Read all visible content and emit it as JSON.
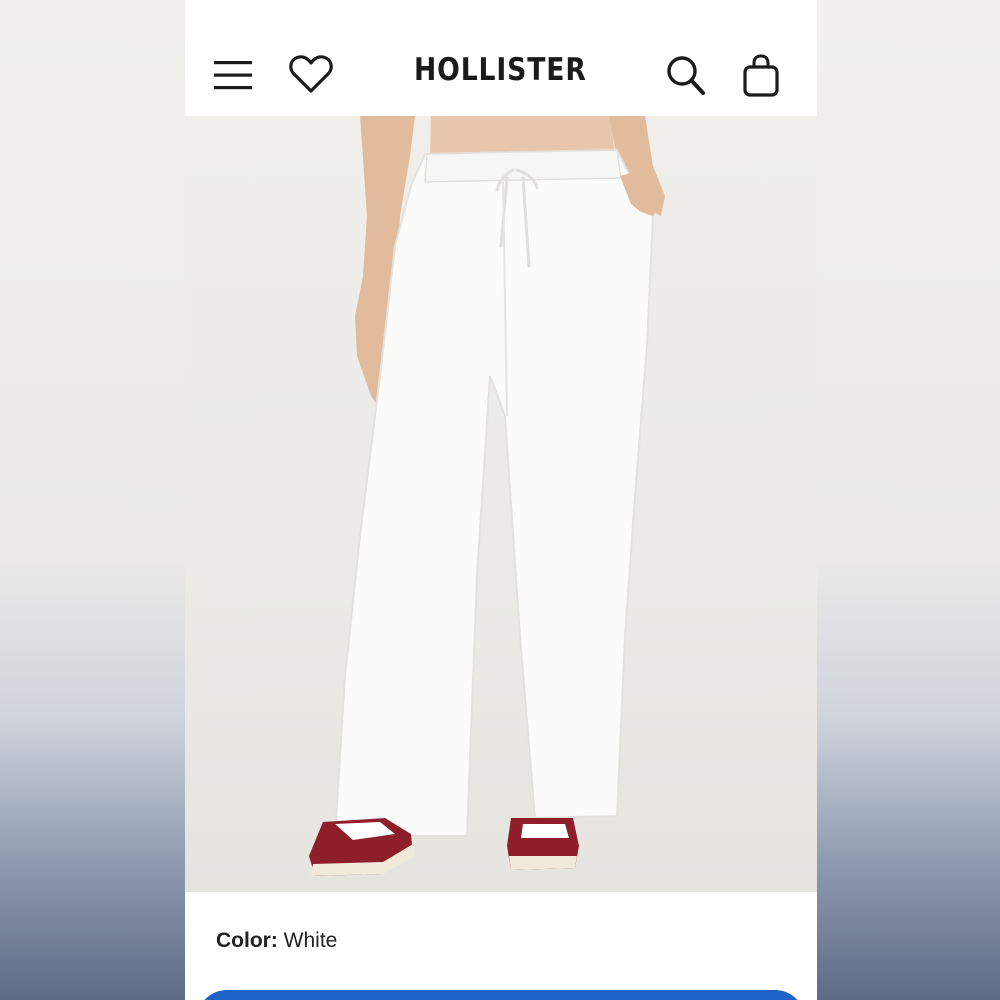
{
  "header": {
    "brand": "HOLLISTER",
    "icons": [
      "menu-icon",
      "heart-icon",
      "search-icon",
      "shopping-bag-icon"
    ]
  },
  "product": {
    "image_subject": "white-wide-leg-linen-pants",
    "color_label": "Color:",
    "color_value": "White"
  },
  "colors": {
    "accent_button": "#1e62c8",
    "text": "#222222",
    "header_bg": "#ffffff"
  }
}
